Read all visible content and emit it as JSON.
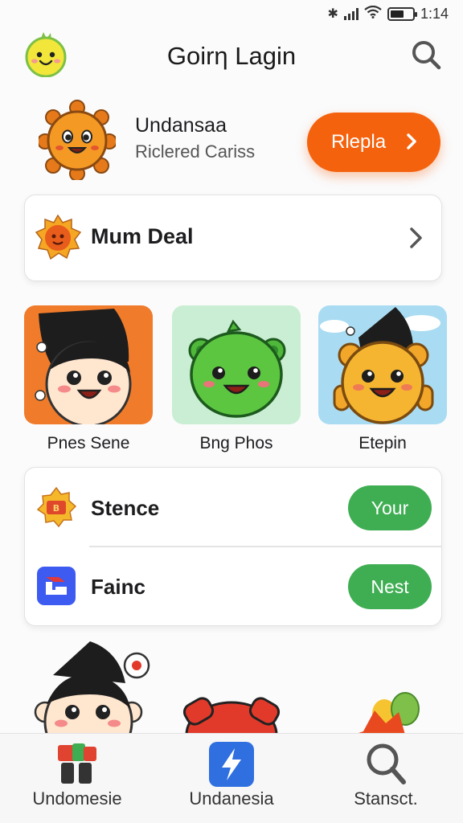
{
  "status_bar": {
    "time": "1:14"
  },
  "header": {
    "title": "Goirη Lagin"
  },
  "hero": {
    "name": "Undansaa",
    "subtitle": "Riclered Cariss",
    "button_label": "Rlepla"
  },
  "deal": {
    "label": "Mum Deal"
  },
  "tiles": [
    {
      "label": "Pnes Sene"
    },
    {
      "label": "Bng Phos"
    },
    {
      "label": "Etepin"
    }
  ],
  "list": [
    {
      "label": "Stence",
      "button_label": "Your"
    },
    {
      "label": "Fainc",
      "button_label": "Nest"
    }
  ],
  "tabs": [
    {
      "label": "Undomesie"
    },
    {
      "label": "Undanesia"
    },
    {
      "label": "Stansct."
    }
  ],
  "colors": {
    "accent_orange": "#f4620e",
    "green": "#3fae53",
    "blue": "#2f6fe0"
  }
}
